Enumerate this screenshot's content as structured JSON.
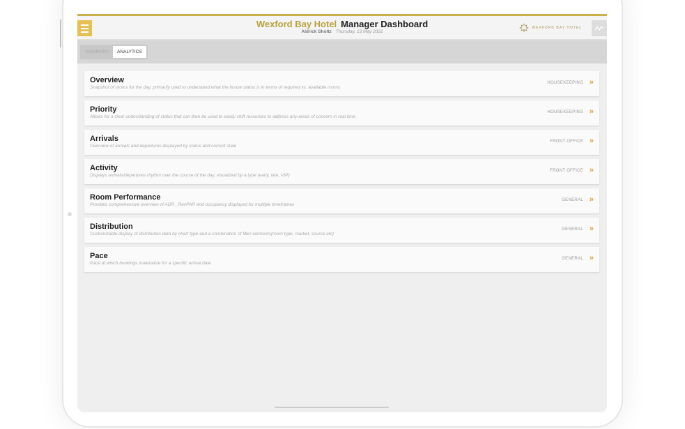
{
  "header": {
    "hotel": "Wexford Bay Hotel",
    "title": "Manager Dashboard",
    "user": "Aldrick Sholtz",
    "date": "Thursday, 13 May 2021",
    "logo_text": "WEXFORD BAY HOTEL"
  },
  "tabs": [
    {
      "label": "SUMMARY"
    },
    {
      "label": "ANALYTICS"
    }
  ],
  "items": [
    {
      "title": "Overview",
      "desc": "Snapshot of rooms for the day, primarily used to understand what the house status is in terms of required vs. available rooms",
      "category": "HOUSEKEEPING"
    },
    {
      "title": "Priority",
      "desc": "Allows for a clear understanding of status that can then be used to easily shift resources to address any areas of concern in real time",
      "category": "HOUSEKEEPING"
    },
    {
      "title": "Arrivals",
      "desc": "Overview of arrivals and departures displayed by status and current state",
      "category": "FRONT OFFICE"
    },
    {
      "title": "Activity",
      "desc": "Displays arrivals/departures rhythm over the course of the day, visualized by a type (early, late, VIP)",
      "category": "FRONT OFFICE"
    },
    {
      "title": "Room Performance",
      "desc": "Provides comprehensive overview of ADR , RevPAR and occupancy displayed for multiple timeframes",
      "category": "GENERAL"
    },
    {
      "title": "Distribution",
      "desc": "Customizable display of distribution data by chart type and a combination of filter elements(room type, market, source etc)",
      "category": "GENERAL"
    },
    {
      "title": "Pace",
      "desc": "Pace at which bookings materialize for a specific arrival date",
      "category": "GENERAL"
    }
  ],
  "colors": {
    "accent": "#c9b04a",
    "chevron": "#e0a030"
  }
}
